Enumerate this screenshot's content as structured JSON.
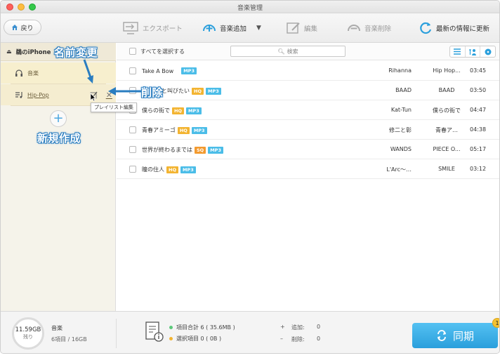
{
  "window": {
    "title": "音楽管理"
  },
  "toolbar": {
    "back_label": "戻り",
    "export_label": "エクスポート",
    "add_music_label": "音楽追加",
    "edit_label": "編集",
    "delete_music_label": "音楽削除",
    "refresh_label": "最新の情報に更新"
  },
  "sidebar": {
    "device_name": "鵜のiPhone",
    "playlists": [
      {
        "label": "音楽"
      },
      {
        "label": "Hip-Pop"
      }
    ],
    "tooltip": "プレイリスト編集"
  },
  "annotations": {
    "rename": "名前変更",
    "delete": "削除",
    "new_create": "新規作成"
  },
  "list": {
    "select_all_label": "すべてを選択する",
    "search_placeholder": "検索",
    "songs": [
      {
        "title": "Take A Bow",
        "badges": [
          "MP3"
        ],
        "artist": "Rihanna",
        "album": "Hip Hop...",
        "time": "03:45"
      },
      {
        "title": "…と叫びたい",
        "badges": [
          "HQ",
          "MP3"
        ],
        "artist": "BAAD",
        "album": "BAAD",
        "time": "03:50"
      },
      {
        "title": "僕らの街で",
        "badges": [
          "HQ",
          "MP3"
        ],
        "artist": "Kat-Tun",
        "album": "僕らの街で",
        "time": "04:47"
      },
      {
        "title": "青春アミーゴ",
        "badges": [
          "HQ",
          "MP3"
        ],
        "artist": "修二と彰",
        "album": "青春ア…",
        "time": "04:38"
      },
      {
        "title": "世界が終わるまでは",
        "badges": [
          "SQ",
          "MP3"
        ],
        "artist": "WANDS",
        "album": "PIECE O...",
        "time": "05:17"
      },
      {
        "title": "瞳の住人",
        "badges": [
          "HQ",
          "MP3"
        ],
        "artist": "L'Arc～…",
        "album": "SMILE",
        "time": "03:12"
      }
    ]
  },
  "footer": {
    "storage_free": "11.59GB",
    "storage_free_label": "残り",
    "media_label": "音楽",
    "media_count": "6項目 / 16GB",
    "total_items": "項目合計 6 ( 35.6MB )",
    "selected_items": "選択項目 0 ( 0B )",
    "add_label": "追加:",
    "add_value": "0",
    "delete_label": "削除:",
    "delete_value": "0",
    "sync_label": "同期",
    "sync_badge": "1"
  },
  "colors": {
    "accent_blue": "#2a9fdc",
    "mp3_badge": "#4bbde8",
    "hq_badge": "#f3b431",
    "sidebar_selected": "#f7efce"
  }
}
